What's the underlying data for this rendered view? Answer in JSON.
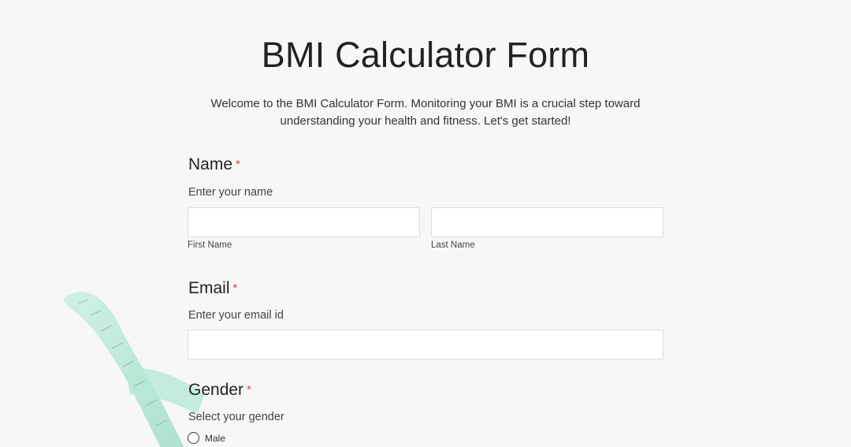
{
  "form": {
    "title": "BMI Calculator Form",
    "description": "Welcome to the BMI Calculator Form. Monitoring your BMI is a crucial step toward understanding your health and fitness. Let's get started!"
  },
  "fields": {
    "name": {
      "label": "Name",
      "required_mark": "*",
      "subtitle": "Enter your name",
      "first_name_label": "First Name",
      "last_name_label": "Last Name",
      "first_name_value": "",
      "last_name_value": ""
    },
    "email": {
      "label": "Email",
      "required_mark": "*",
      "subtitle": "Enter your email id",
      "value": ""
    },
    "gender": {
      "label": "Gender",
      "required_mark": "*",
      "subtitle": "Select your gender",
      "options": [
        "Male"
      ]
    }
  },
  "colors": {
    "required": "#e0464a",
    "background": "#f7f7f7",
    "tape": "#a8e3cf"
  },
  "background_image": "measuring-tape"
}
